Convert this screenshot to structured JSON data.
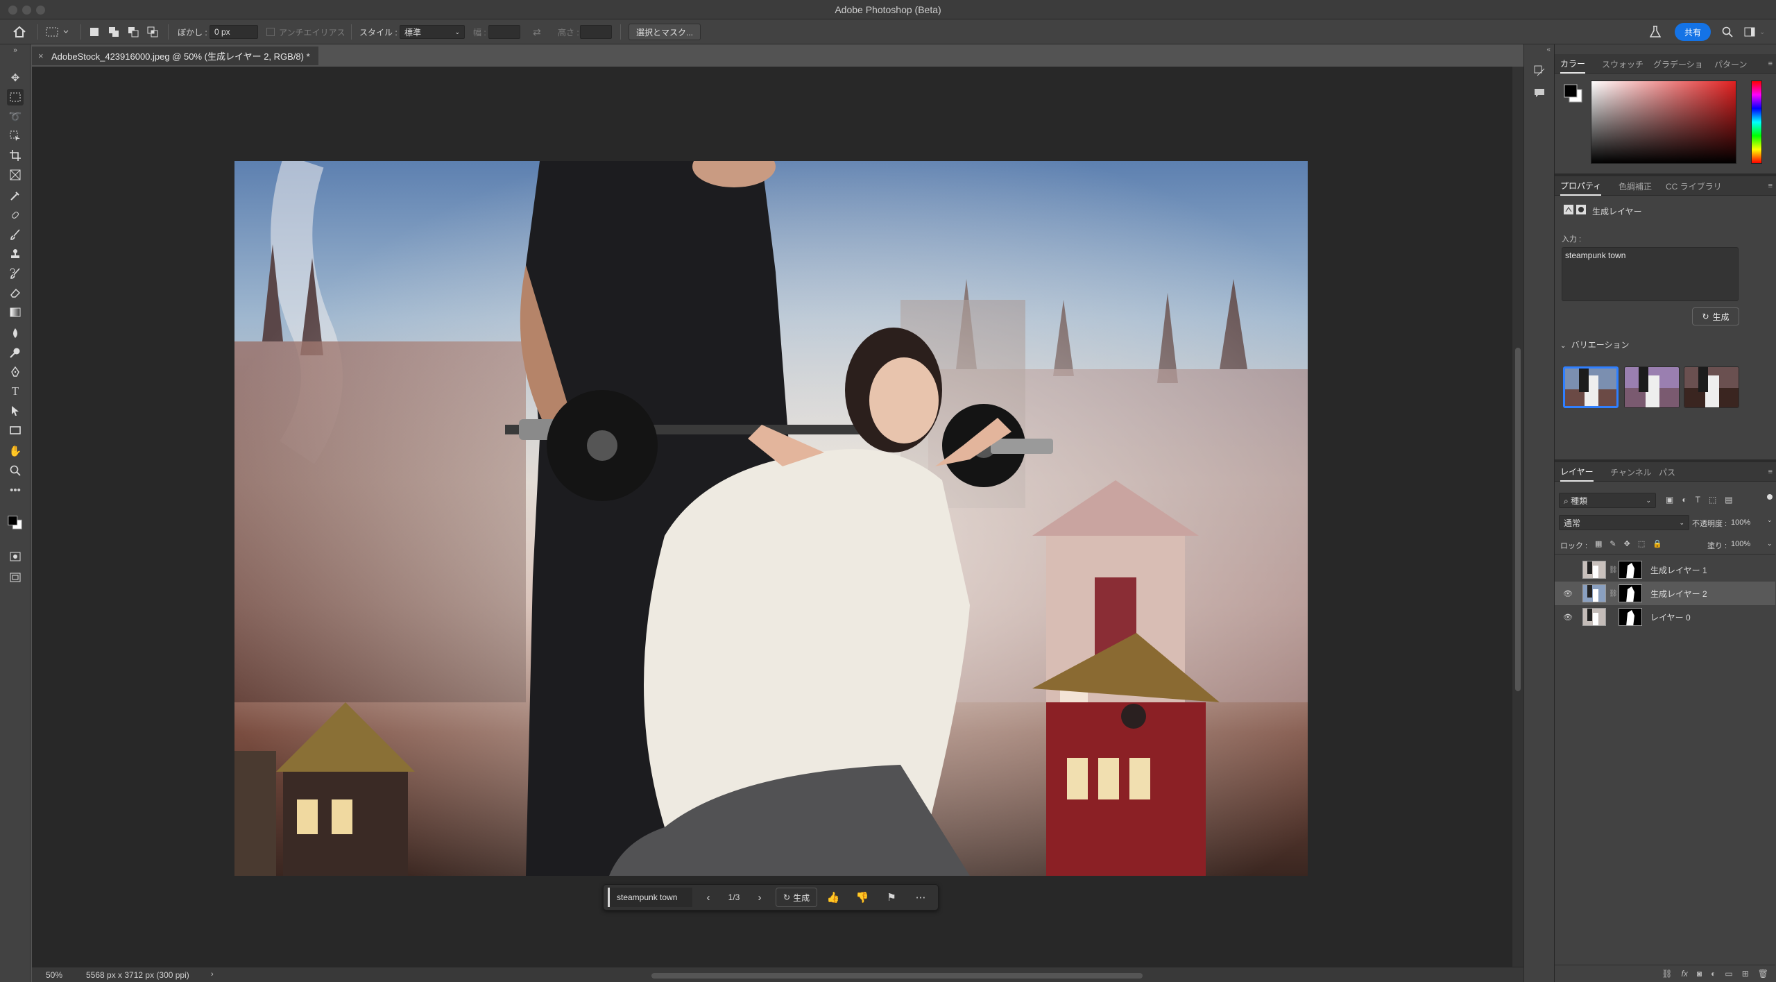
{
  "window": {
    "title": "Adobe Photoshop (Beta)"
  },
  "options_bar": {
    "feather_label": "ぼかし :",
    "feather_value": "0 px",
    "antialias_label": "アンチエイリアス",
    "style_label": "スタイル :",
    "style_value": "標準",
    "width_label": "幅 :",
    "height_label": "高さ :",
    "select_mask_label": "選択とマスク...",
    "share_label": "共有"
  },
  "document": {
    "tab_label": "AdobeStock_423916000.jpeg @ 50% (生成レイヤー 2, RGB/8) *",
    "close_glyph": "×"
  },
  "contextual_bar": {
    "prompt": "steampunk town",
    "counter": "1/3",
    "generate_label": "生成"
  },
  "status_bar": {
    "zoom": "50%",
    "doc_info": "5568 px x 3712 px (300 ppi)"
  },
  "color_panel": {
    "tabs": [
      "カラー",
      "スウォッチ",
      "グラデーショ",
      "パターン"
    ]
  },
  "properties_panel": {
    "tabs": [
      "プロパティ",
      "色調補正",
      "CC ライブラリ"
    ],
    "layer_type": "生成レイヤー",
    "input_label": "入力 :",
    "prompt_text": "steampunk town",
    "generate_label": "生成",
    "variations_label": "バリエーション"
  },
  "layers_panel": {
    "tabs": [
      "レイヤー",
      "チャンネル",
      "パス"
    ],
    "filter_kind": "種類",
    "blend_mode": "通常",
    "opacity_label": "不透明度 :",
    "opacity_value": "100%",
    "lock_label": "ロック :",
    "fill_label": "塗り :",
    "fill_value": "100%",
    "layers": [
      {
        "name": "生成レイヤー 1",
        "visible": false,
        "selected": false
      },
      {
        "name": "生成レイヤー 2",
        "visible": true,
        "selected": true
      },
      {
        "name": "レイヤー 0",
        "visible": true,
        "selected": false
      }
    ]
  },
  "colors": {
    "accent": "#1473e6",
    "selection": "#2f7fff"
  }
}
